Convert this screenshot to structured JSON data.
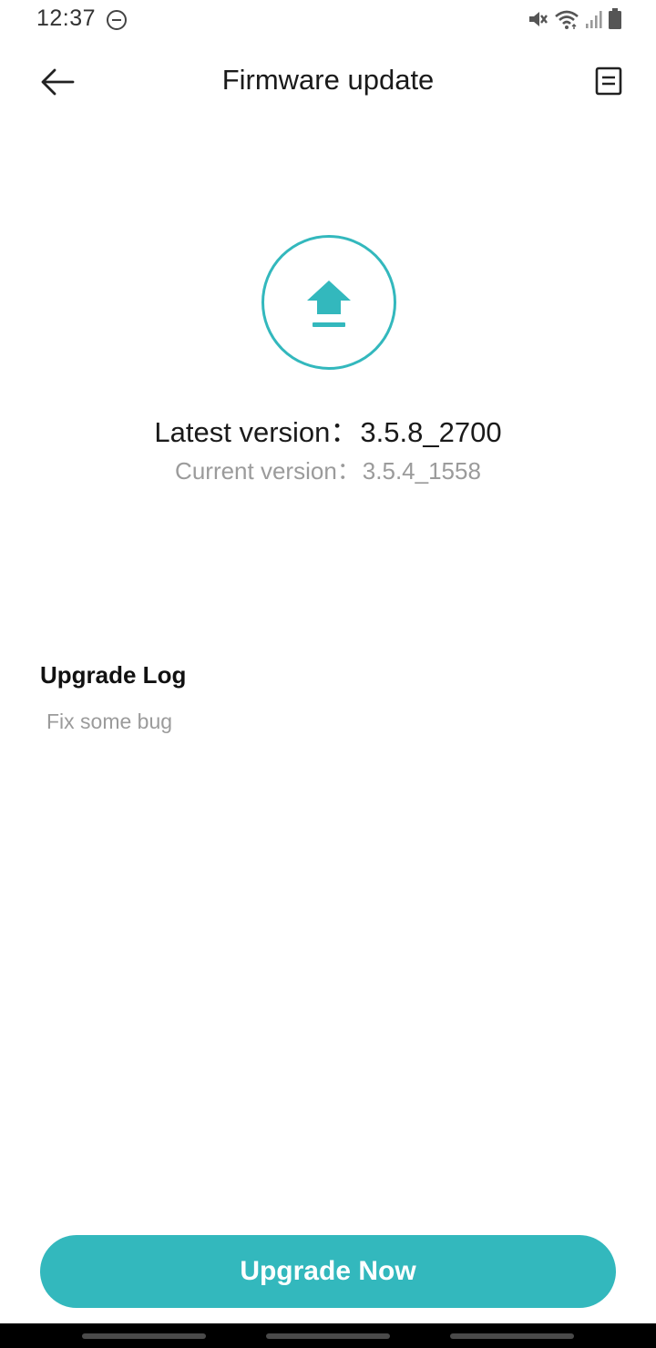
{
  "status_bar": {
    "time": "12:37",
    "icons": [
      "do-not-disturb-icon",
      "vibrate-mute-icon",
      "wifi-icon",
      "signal-icon",
      "battery-icon"
    ]
  },
  "header": {
    "title": "Firmware update",
    "back_icon": "back-arrow-icon",
    "menu_icon": "document-icon"
  },
  "firmware": {
    "icon": "upload-arrow-icon",
    "latest_label": "Latest version：",
    "latest_value": "3.5.8_2700",
    "current_label": "Current version：",
    "current_value": "3.5.4_1558"
  },
  "upgrade_log": {
    "title": "Upgrade Log",
    "text": "Fix some bug"
  },
  "action": {
    "button_label": "Upgrade Now"
  },
  "colors": {
    "accent": "#33b8bd",
    "secondary_text": "#9b9b9b"
  }
}
